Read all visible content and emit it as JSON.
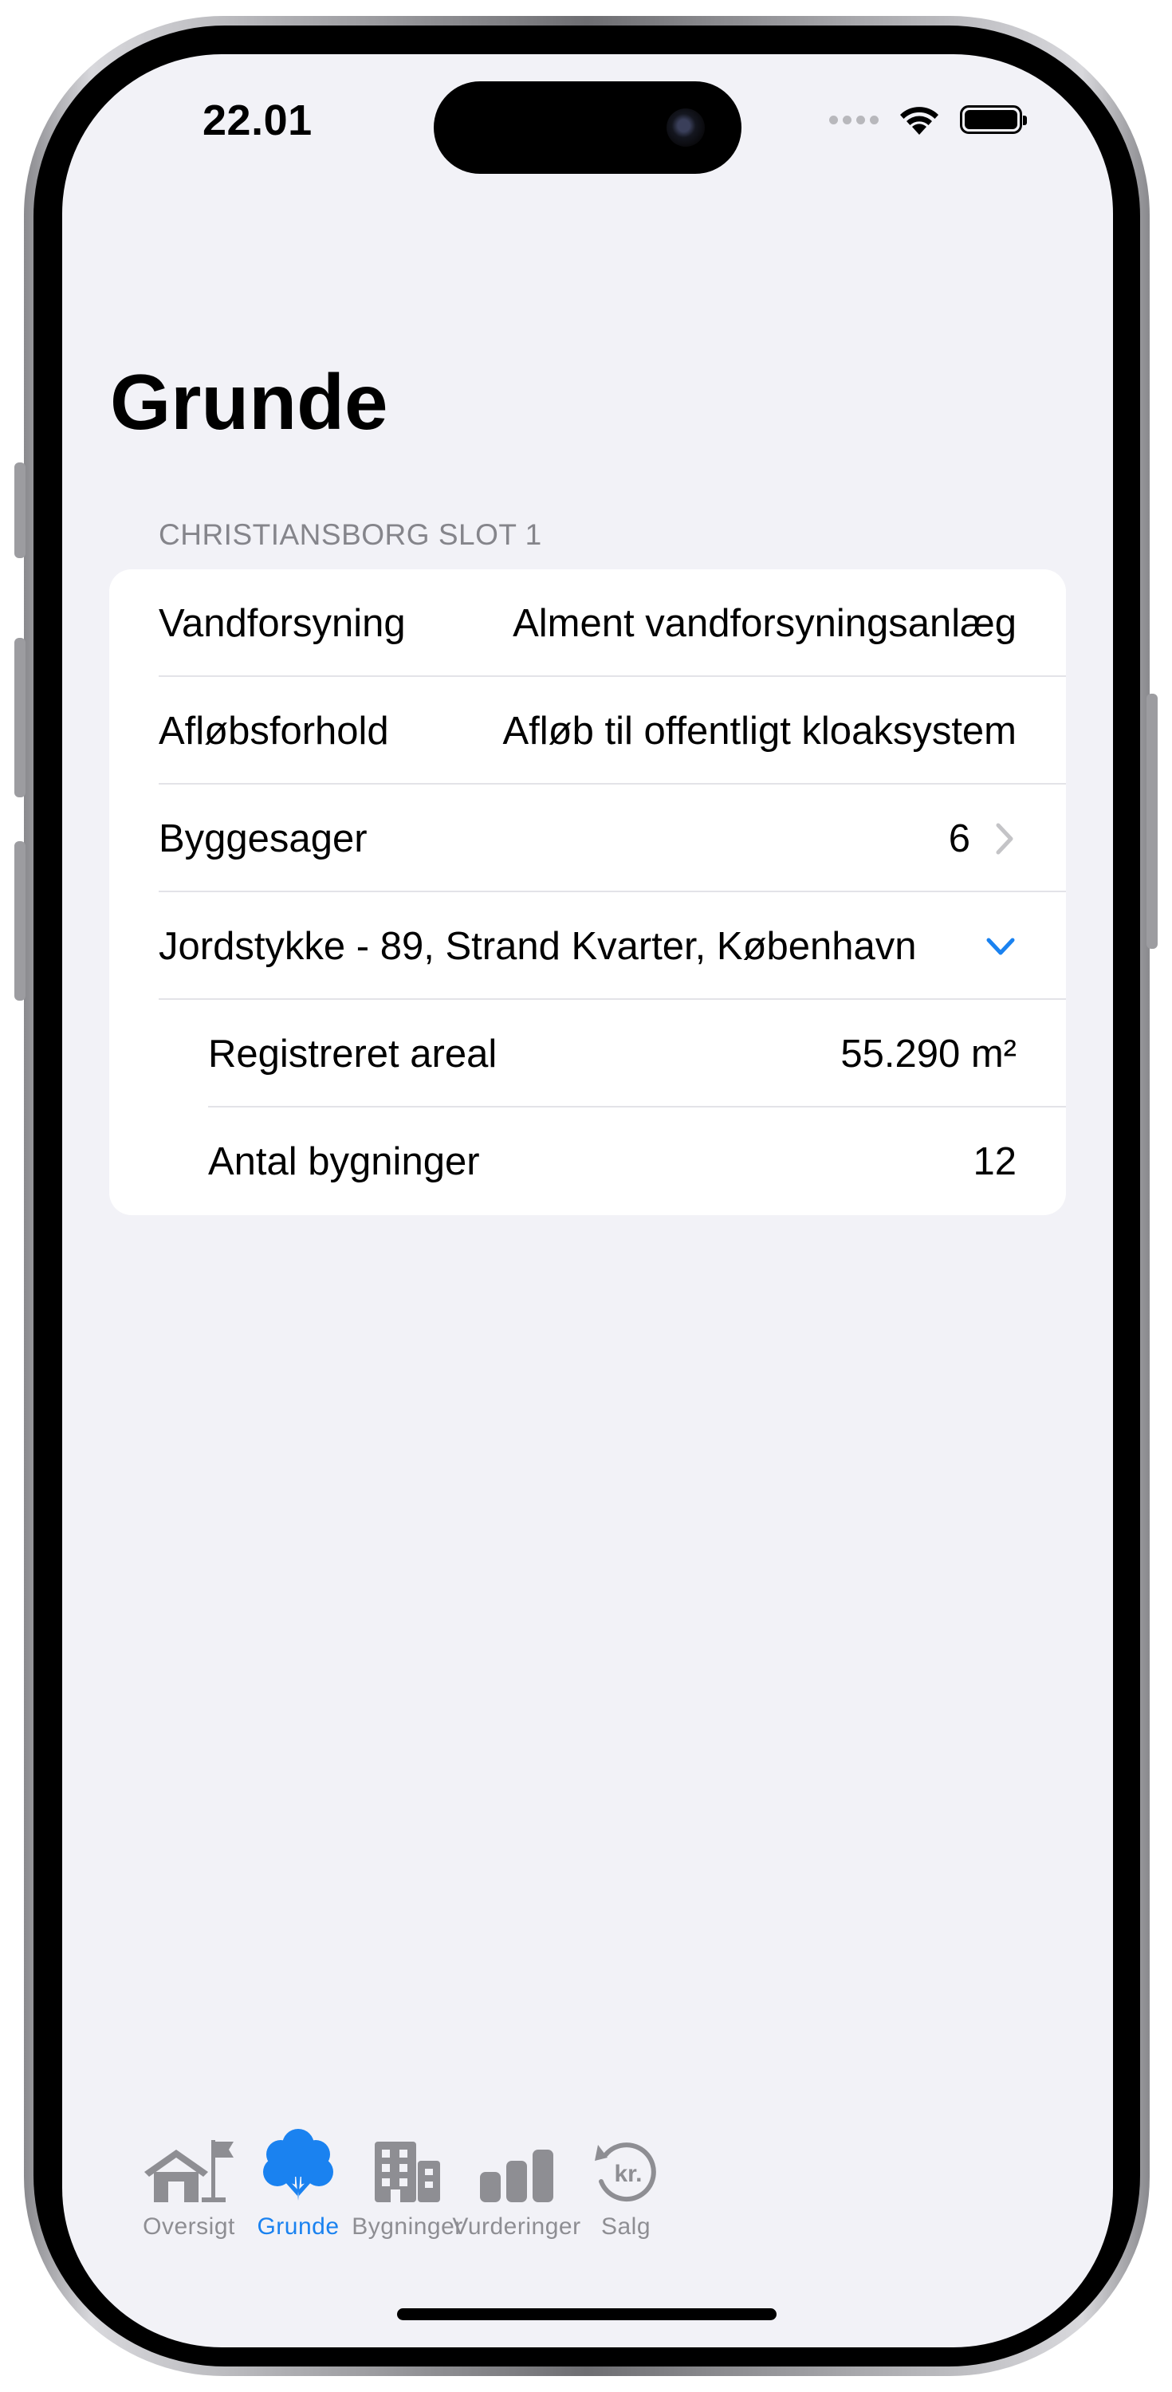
{
  "status_bar": {
    "time": "22.01"
  },
  "page": {
    "title": "Grunde"
  },
  "section": {
    "header": "CHRISTIANSBORG SLOT 1",
    "rows": [
      {
        "label": "Vandforsyning",
        "value": "Alment vandforsyningsanlæg"
      },
      {
        "label": "Afløbsforhold",
        "value": "Afløb til offentligt kloaksystem"
      },
      {
        "label": "Byggesager",
        "value": "6"
      },
      {
        "label": "Jordstykke - 89, Strand Kvarter, København",
        "value": ""
      },
      {
        "label": "Registreret areal",
        "value": "55.290 m²"
      },
      {
        "label": "Antal bygninger",
        "value": "12"
      }
    ]
  },
  "tabbar": {
    "tabs": [
      {
        "label": "Oversigt",
        "icon": "house-flag-icon"
      },
      {
        "label": "Grunde",
        "icon": "tree-icon"
      },
      {
        "label": "Bygninger",
        "icon": "building-icon"
      },
      {
        "label": "Vurderinger",
        "icon": "bar-chart-icon"
      },
      {
        "label": "Salg",
        "icon": "kr-history-icon"
      }
    ],
    "active_index": 1
  },
  "colors": {
    "accent": "#1a82f0",
    "inactive": "#8e8e93",
    "background": "#f2f2f7"
  }
}
